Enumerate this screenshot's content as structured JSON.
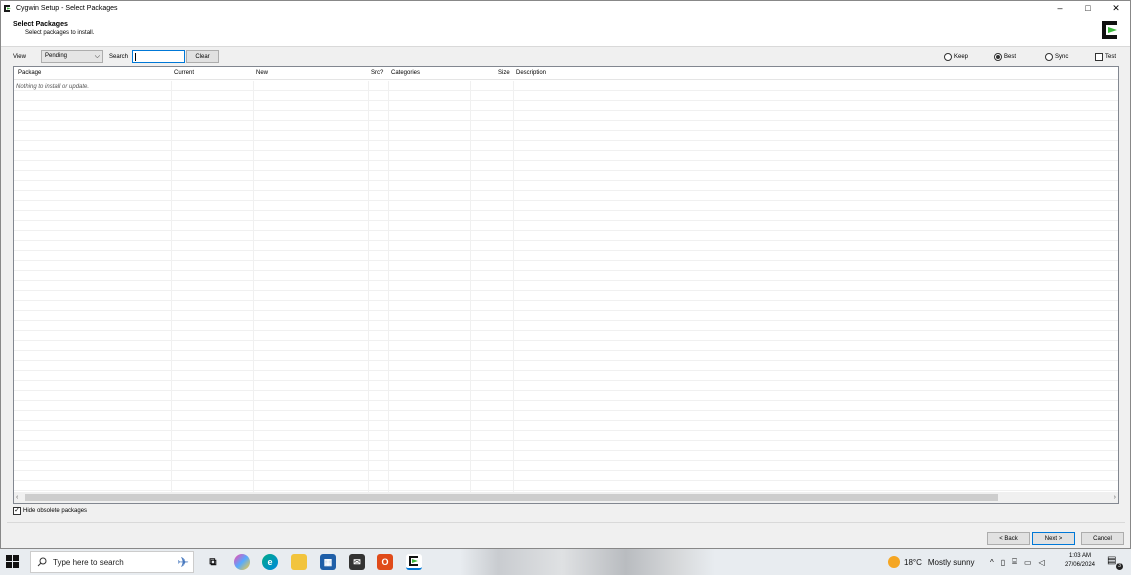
{
  "window": {
    "title": "Cygwin Setup - Select Packages",
    "controls": {
      "minimize": "–",
      "maximize": "□",
      "close": "✕"
    }
  },
  "header": {
    "title": "Select Packages",
    "subtitle": "Select packages to install."
  },
  "toolbar": {
    "view_label": "View",
    "view_value": "Pending",
    "search_label": "Search",
    "search_value": "",
    "clear_label": "Clear",
    "radios": [
      {
        "label": "Keep",
        "selected": false
      },
      {
        "label": "Best",
        "selected": true
      },
      {
        "label": "Sync",
        "selected": false
      }
    ],
    "test_label": "Test",
    "test_checked": false
  },
  "table": {
    "columns": [
      "Package",
      "Current",
      "New",
      "Src?",
      "Categories",
      "Size",
      "Description"
    ],
    "empty_message": "Nothing to install or update."
  },
  "options": {
    "hide_obsolete_label": "Hide obsolete packages",
    "hide_obsolete_checked": true
  },
  "buttons": {
    "back": "< Back",
    "next": "Next >",
    "cancel": "Cancel"
  },
  "taskbar": {
    "search_placeholder": "Type here to search",
    "weather_temp": "18°C",
    "weather_text": "Mostly sunny",
    "time": "1:03 AM",
    "date": "27/06/2024",
    "notification_count": "3"
  },
  "colors": {
    "accent": "#0078d7",
    "cygwin_green": "#3db83d",
    "window_bg": "#f0f0f0"
  }
}
